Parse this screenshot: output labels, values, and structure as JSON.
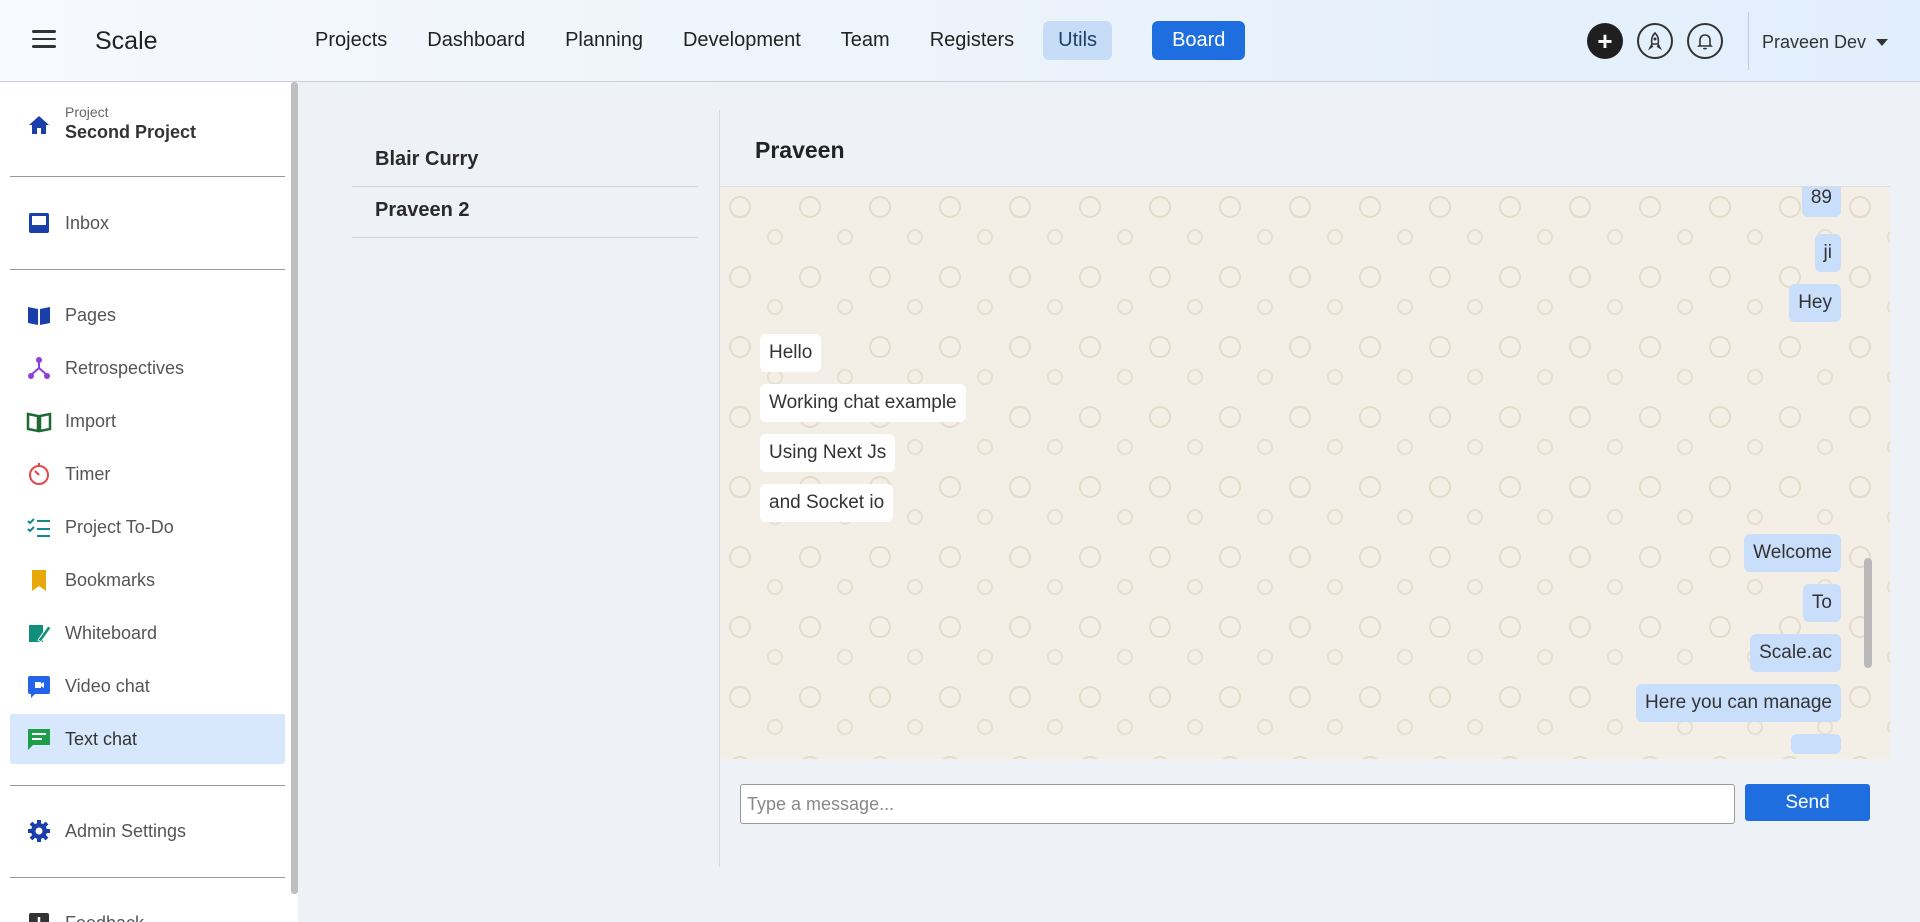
{
  "app": {
    "brand": "Scale"
  },
  "nav": {
    "items": [
      "Projects",
      "Dashboard",
      "Planning",
      "Development",
      "Team",
      "Registers"
    ],
    "utils": "Utils",
    "board": "Board"
  },
  "user": {
    "name": "Praveen Dev"
  },
  "sidebar": {
    "project_label": "Project",
    "project_name": "Second Project",
    "inbox": "Inbox",
    "items": [
      {
        "label": "Pages",
        "icon": "book-open-icon"
      },
      {
        "label": "Retrospectives",
        "icon": "graph-icon"
      },
      {
        "label": "Import",
        "icon": "book-icon"
      },
      {
        "label": "Timer",
        "icon": "timer-icon"
      },
      {
        "label": "Project To-Do",
        "icon": "checklist-icon"
      },
      {
        "label": "Bookmarks",
        "icon": "bookmark-icon"
      },
      {
        "label": "Whiteboard",
        "icon": "pen-icon"
      },
      {
        "label": "Video chat",
        "icon": "video-icon"
      },
      {
        "label": "Text chat",
        "icon": "chat-icon",
        "active": true
      }
    ],
    "admin": "Admin Settings",
    "feedback": "Feedback"
  },
  "contacts": [
    "Blair Curry",
    "Praveen 2"
  ],
  "chat": {
    "title": "Praveen",
    "messages": [
      {
        "text": "89",
        "dir": "out"
      },
      {
        "text": "ji",
        "dir": "out"
      },
      {
        "text": "Hey",
        "dir": "out"
      },
      {
        "text": "Hello",
        "dir": "in"
      },
      {
        "text": "Working chat example",
        "dir": "in"
      },
      {
        "text": "Using Next Js",
        "dir": "in"
      },
      {
        "text": "and Socket io",
        "dir": "in"
      },
      {
        "text": "Welcome",
        "dir": "out"
      },
      {
        "text": "To",
        "dir": "out"
      },
      {
        "text": "Scale.ac",
        "dir": "out"
      },
      {
        "text": "Here you can manage",
        "dir": "out"
      }
    ],
    "placeholder": "Type a message...",
    "send": "Send"
  },
  "colors": {
    "accent": "#1f6ee0",
    "outgoing_bubble": "#c8defa",
    "active_sidebar": "#d8e8fc"
  }
}
